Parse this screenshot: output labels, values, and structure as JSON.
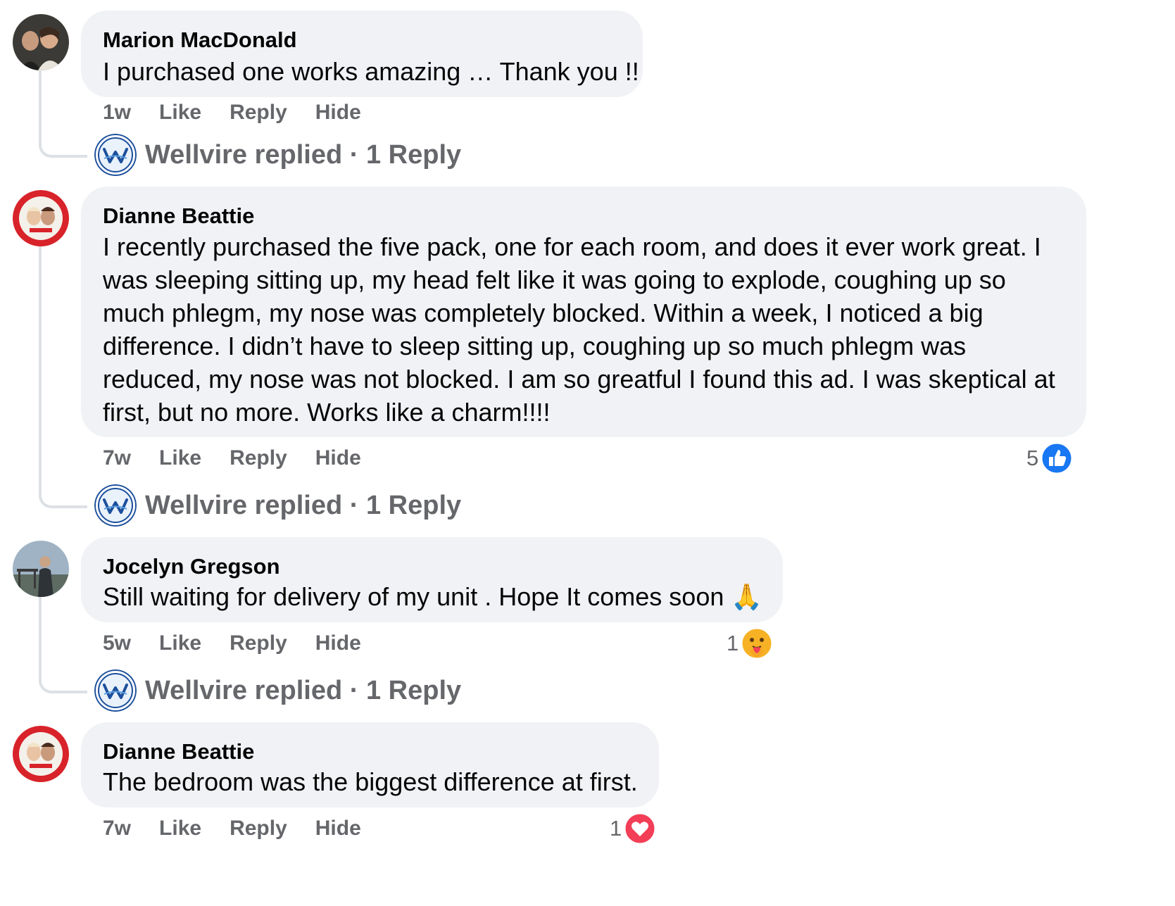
{
  "comments": [
    {
      "author": "Marion MacDonald",
      "lines": [
        "I purchased one works amazing … Thank you !!"
      ],
      "time": "1w",
      "actions": [
        "Like",
        "Reply",
        "Hide"
      ],
      "replied": "Wellvire replied · 1 Reply"
    },
    {
      "author": "Dianne Beattie",
      "lines": [
        "I recently purchased the five pack, one for each room, and does it ever work great. I",
        "was sleeping sitting up, my head felt like it was going to explode, coughing up so",
        "much phlegm, my nose was completely blocked. Within a week, I noticed a big",
        "difference. I didn’t have to sleep sitting up, coughing up so much phlegm was",
        "reduced, my nose was not blocked. I am so greatful I found this ad. I was skeptical at",
        "first, but no more. Works like a charm!!!!"
      ],
      "time": "7w",
      "actions": [
        "Like",
        "Reply",
        "Hide"
      ],
      "reaction_count": "5",
      "reaction_icon": "like-icon",
      "replied": "Wellvire replied · 1 Reply"
    },
    {
      "author": "Jocelyn Gregson",
      "lines": [
        "Still waiting for delivery of my unit . Hope It comes soon 🙏"
      ],
      "time": "5w",
      "actions": [
        "Like",
        "Reply",
        "Hide"
      ],
      "reaction_count": "1",
      "reaction_icon": "care-icon",
      "replied": "Wellvire replied · 1 Reply"
    },
    {
      "author": "Dianne Beattie",
      "lines": [
        "The bedroom was the biggest difference at first."
      ],
      "time": "7w",
      "actions": [
        "Like",
        "Reply",
        "Hide"
      ],
      "reaction_count": "1",
      "reaction_icon": "love-icon"
    }
  ],
  "colors": {
    "bubble": "#f0f2f5",
    "secondary_text": "#65676b",
    "like_blue": "#1877f2",
    "love_red": "#f33e58",
    "care_yellow": "#f7b125",
    "thread_line": "#dde0e4"
  }
}
